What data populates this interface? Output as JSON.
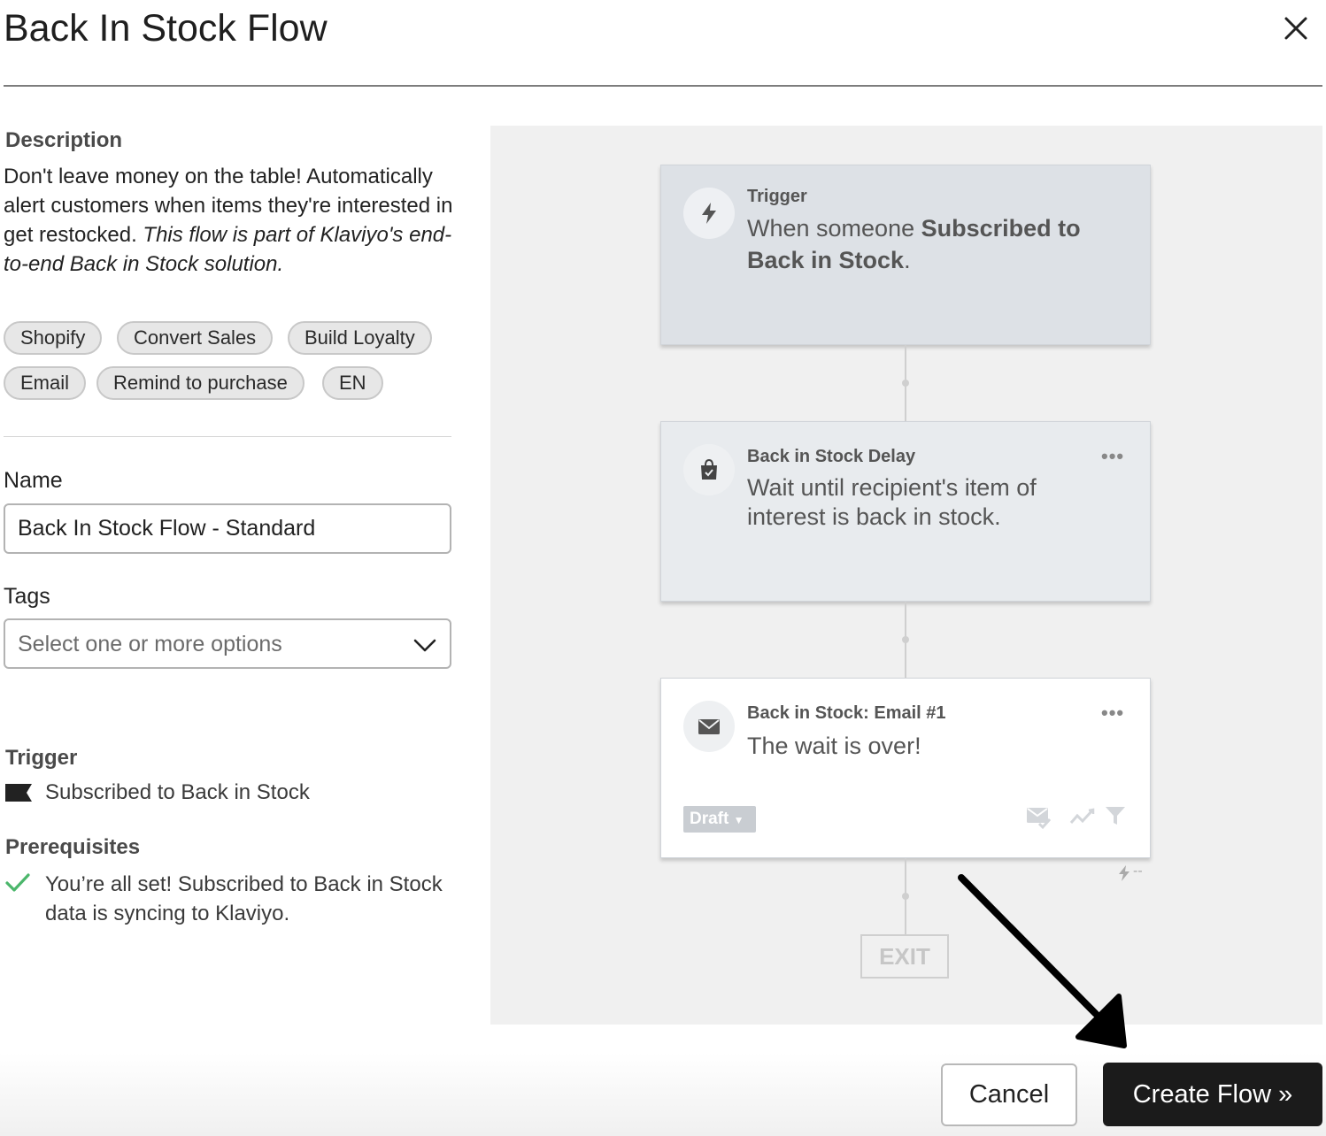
{
  "modal": {
    "title": "Back In Stock Flow"
  },
  "description": {
    "label": "Description",
    "text_plain": "Don't leave money on the table! Automatically alert customers when items they're interested in get restocked. ",
    "text_italic": "This flow is part of Klaviyo's end-to-end Back in Stock solution."
  },
  "chips": [
    "Shopify",
    "Convert Sales",
    "Build Loyalty",
    "Email",
    "Remind to purchase",
    "EN"
  ],
  "form": {
    "name_label": "Name",
    "name_value": "Back In Stock Flow - Standard",
    "tags_label": "Tags",
    "tags_placeholder": "Select one or more options"
  },
  "trigger": {
    "label": "Trigger",
    "value": "Subscribed to Back in Stock"
  },
  "prerequisites": {
    "label": "Prerequisites",
    "text": "You’re all set! Subscribed to Back in Stock data is syncing to Klaviyo."
  },
  "flow_preview": {
    "trigger_node": {
      "label": "Trigger",
      "text_prefix": "When someone ",
      "text_bold": "Subscribed to Back in Stock",
      "text_suffix": "."
    },
    "delay_node": {
      "label": "Back in Stock Delay",
      "text": "Wait until recipient's item of interest is back in stock.",
      "menu": "•••"
    },
    "email_node": {
      "label": "Back in Stock: Email #1",
      "text": "The wait is over!",
      "menu": "•••",
      "status": "Draft",
      "stat": "--"
    },
    "exit_label": "EXIT"
  },
  "footer": {
    "cancel_label": "Cancel",
    "create_label": "Create Flow »"
  },
  "colors": {
    "primary_button": "#1b1b1b",
    "trigger_node_bg": "#dde1e6",
    "delay_node_bg": "#e8ebee",
    "check_green": "#4bb66b"
  }
}
